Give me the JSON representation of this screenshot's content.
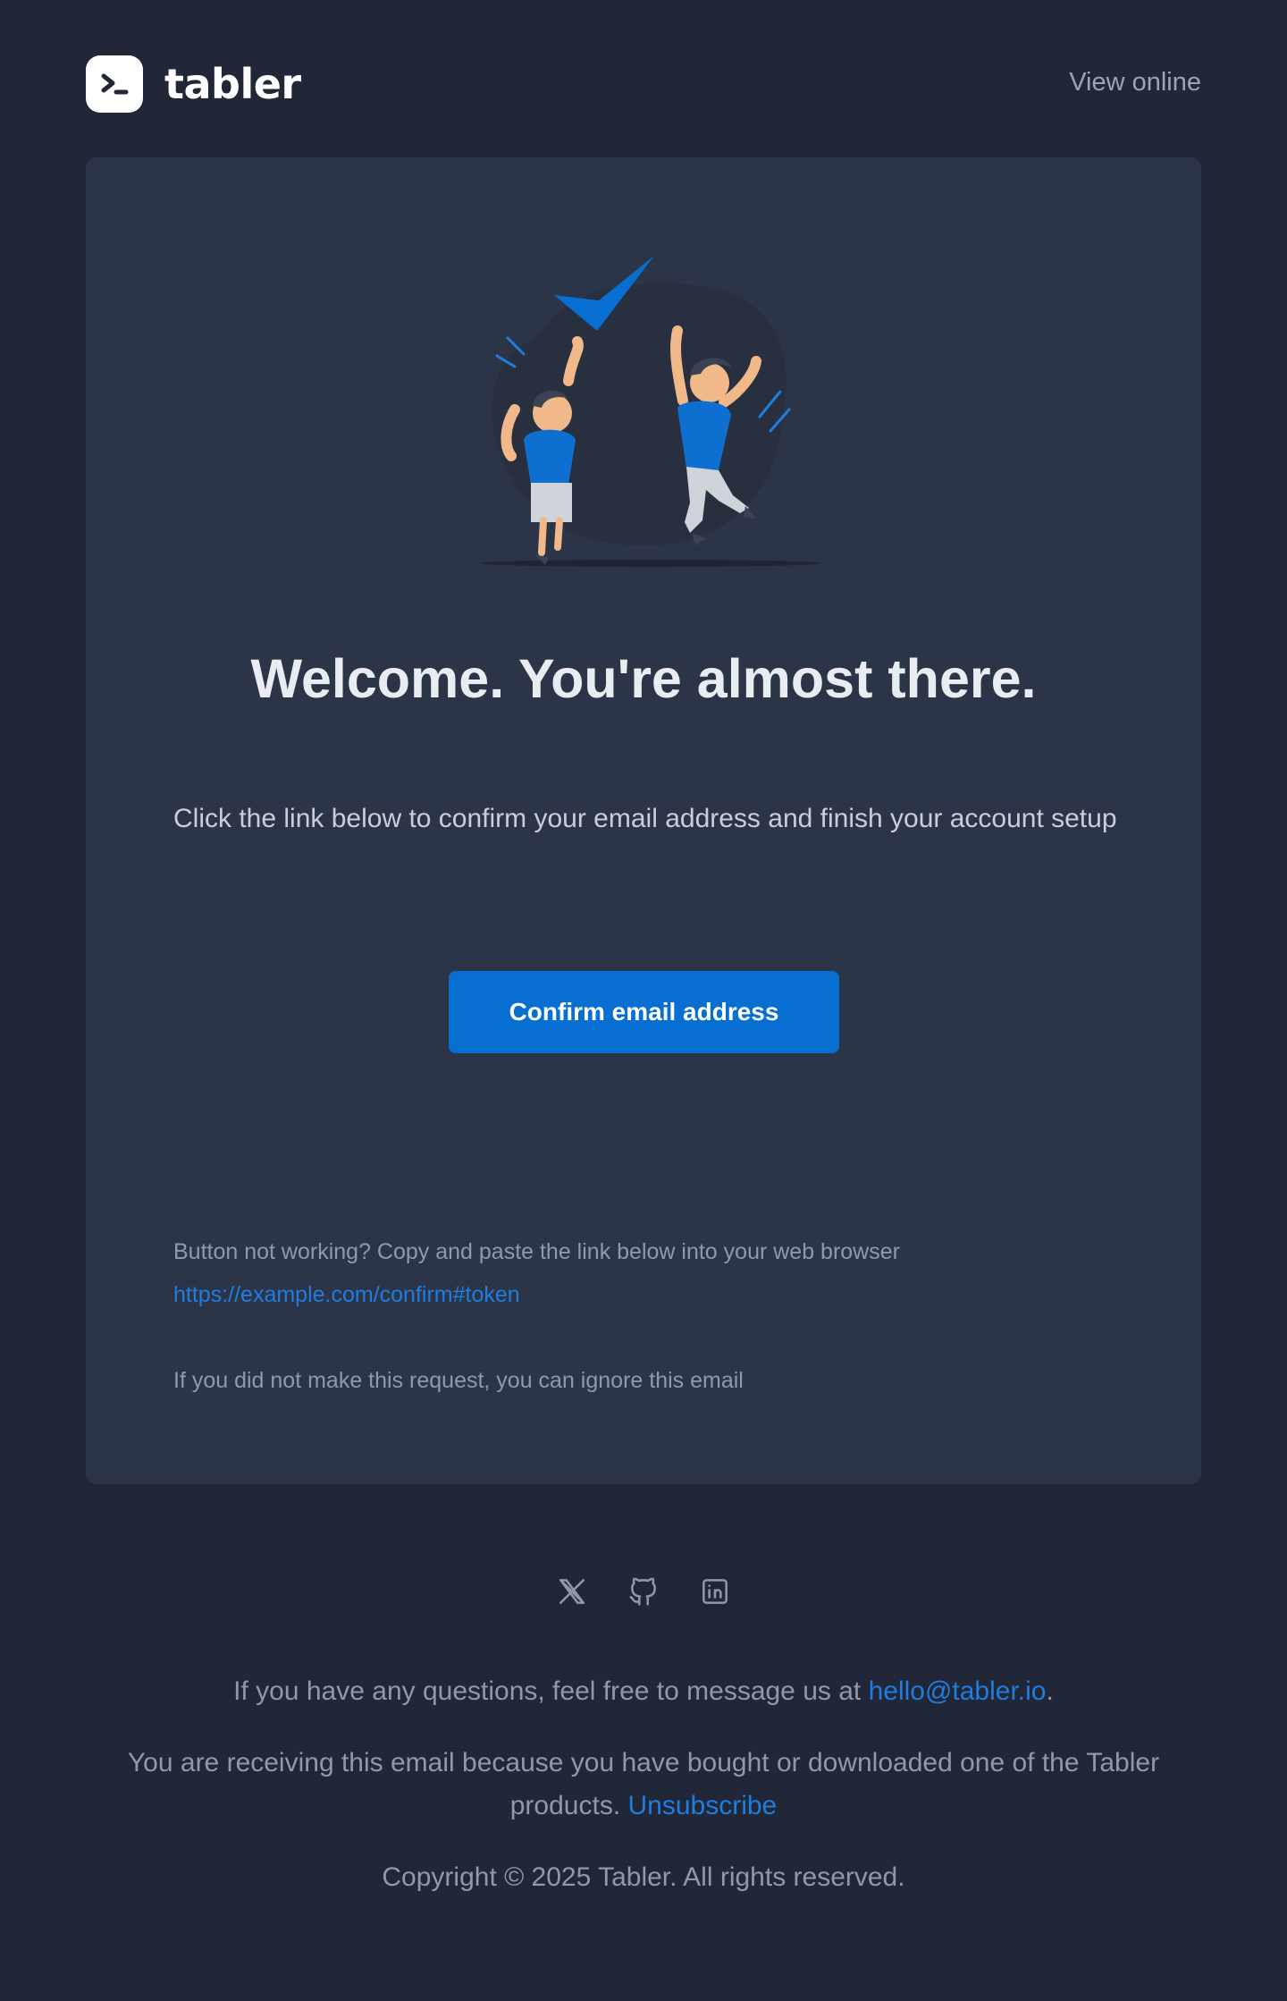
{
  "header": {
    "brand": "tabler",
    "view_online": "View online"
  },
  "card": {
    "title": "Welcome. You're almost there.",
    "text": "Click the link below to confirm your email address and finish your account setup",
    "button_label": "Confirm email address",
    "help_text": "Button not working? Copy and paste the link below into your web browser",
    "help_link": "https://example.com/confirm#token",
    "ignore_text": "If you did not make this request, you can ignore this email"
  },
  "footer": {
    "socials": [
      "x-icon",
      "github-icon",
      "linkedin-icon"
    ],
    "questions_prefix": "If you have any questions, feel free to message us at ",
    "contact_email": "hello@tabler.io",
    "questions_suffix": ".",
    "receiving_text": "You are receiving this email because you have bought or downloaded one of the Tabler products. ",
    "unsubscribe": "Unsubscribe",
    "copyright": "Copyright © 2025 Tabler. All rights reserved."
  },
  "colors": {
    "background": "#212736",
    "card": "#2c3547",
    "accent": "#066fd1",
    "link": "#1f7de0",
    "muted_text": "#8e9aab"
  }
}
